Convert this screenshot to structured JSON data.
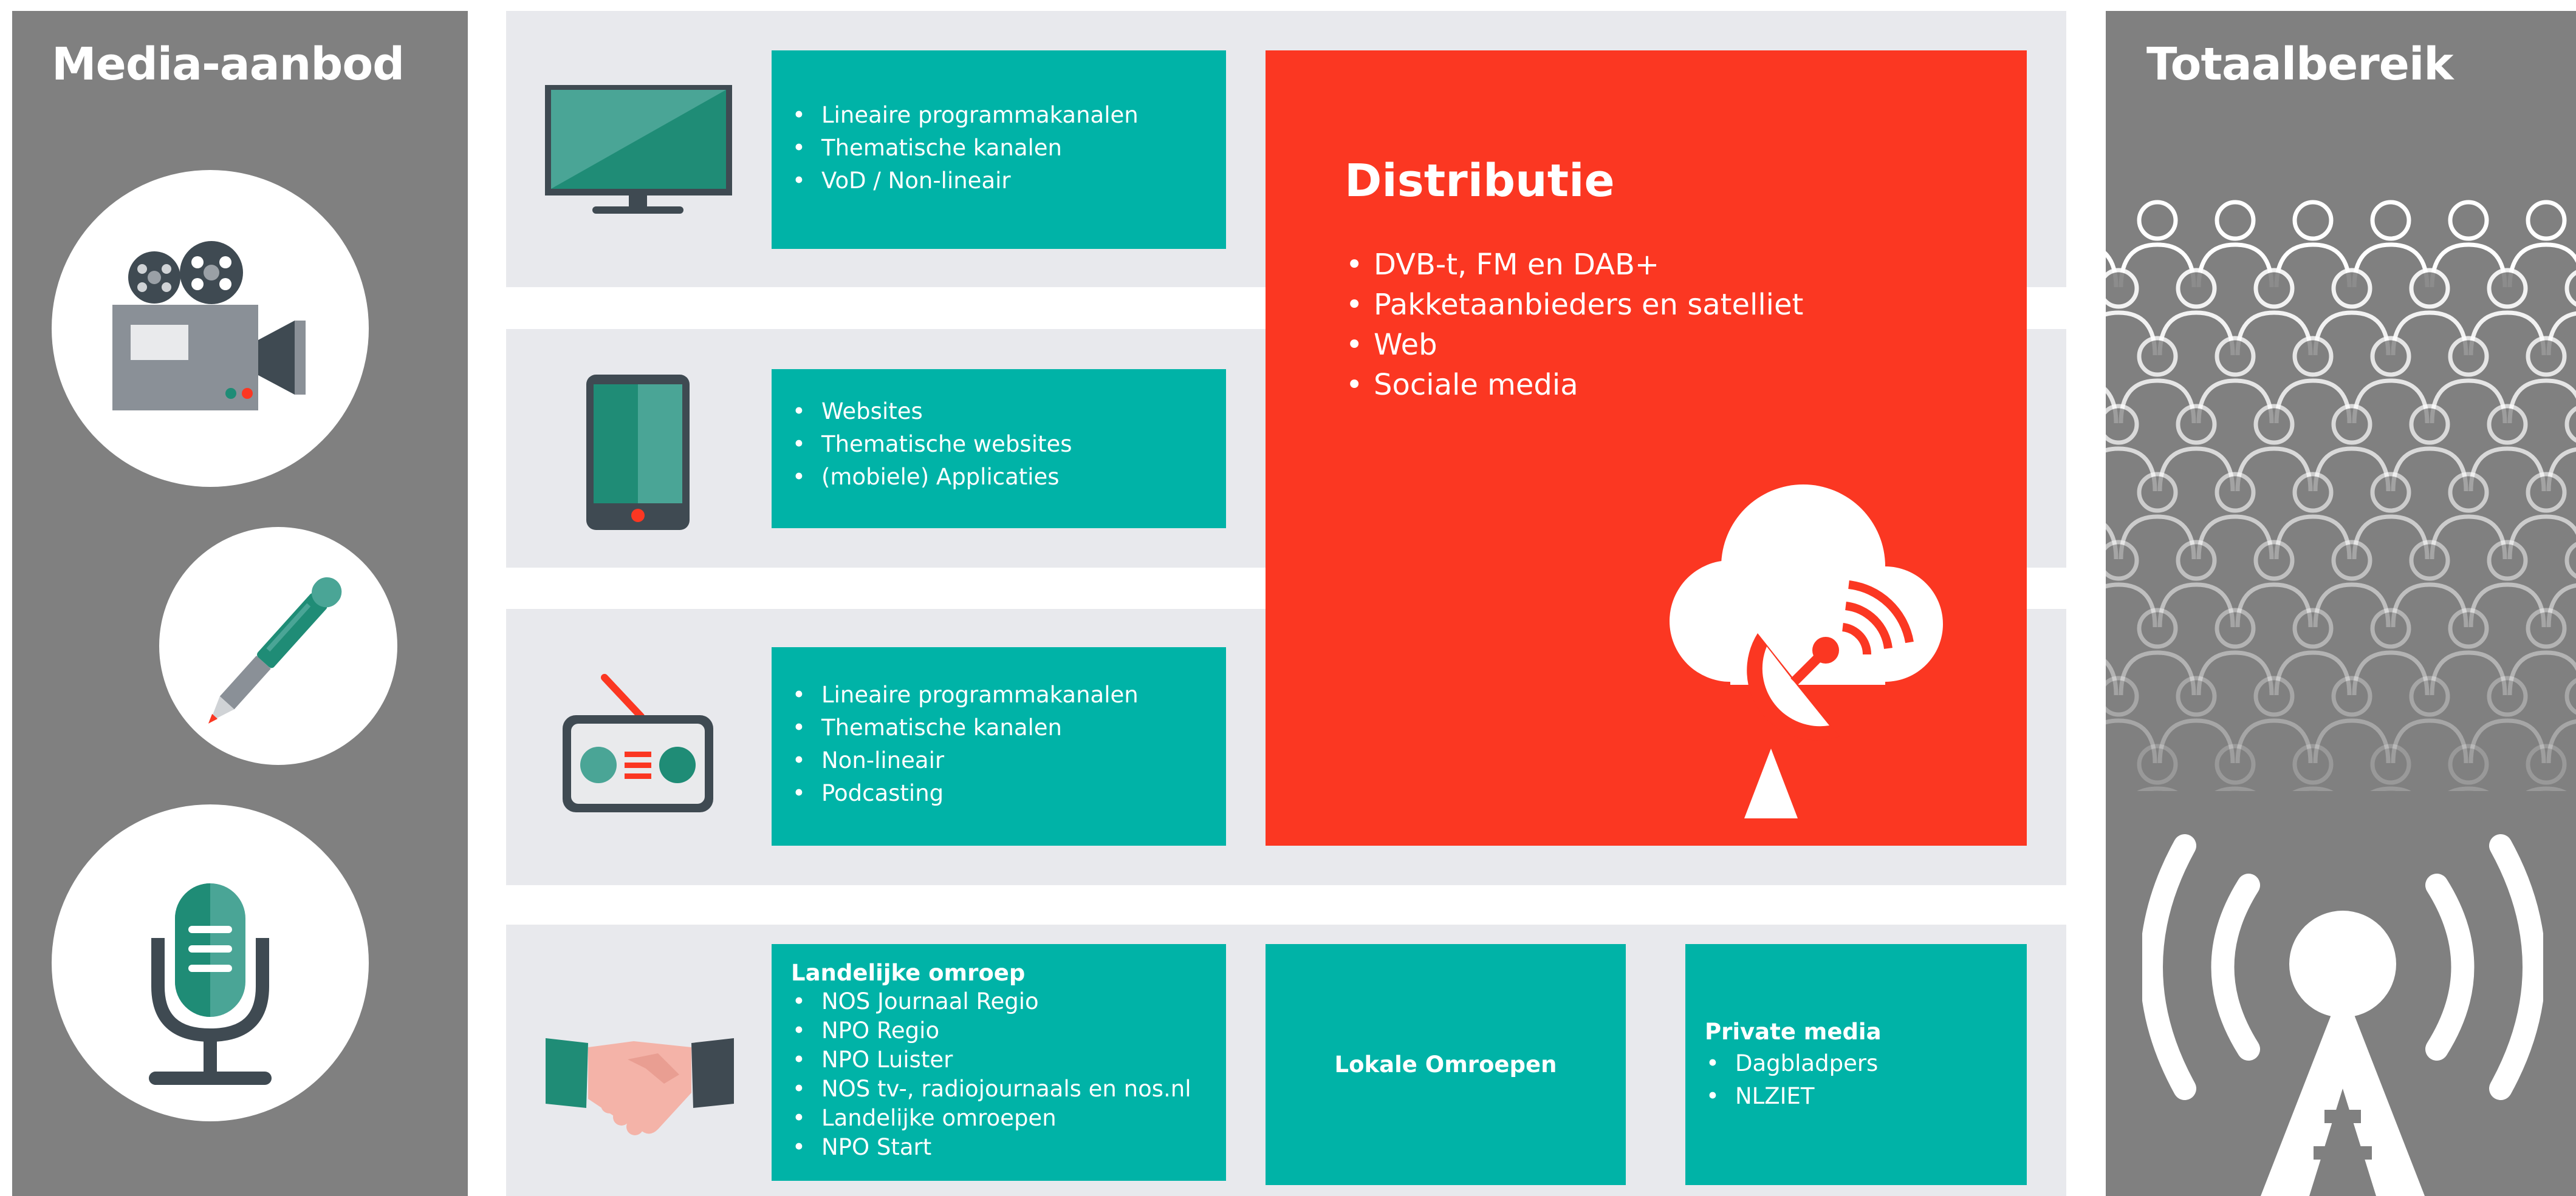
{
  "left_panel": {
    "title": "Media-aanbod"
  },
  "right_panel": {
    "title": "Totaalbereik"
  },
  "rows": {
    "tv": {
      "items": [
        "Lineaire programmakanalen",
        "Thematische kanalen",
        "VoD / Non-lineair"
      ]
    },
    "online": {
      "items": [
        "Websites",
        "Thematische websites",
        "(mobiele) Applicaties"
      ]
    },
    "radio": {
      "items": [
        "Lineaire programmakanalen",
        "Thematische kanalen",
        "Non-lineair",
        "Podcasting"
      ]
    }
  },
  "distributie": {
    "title": "Distributie",
    "items": [
      "DVB-t, FM en DAB+",
      "Pakketaanbieders en satelliet",
      "Web",
      "Sociale media"
    ]
  },
  "partners": {
    "landelijke": {
      "title": "Landelijke omroep",
      "items": [
        "NOS Journaal Regio",
        "NPO Regio",
        "NPO Luister",
        "NOS tv-, radiojournaals en nos.nl",
        "Landelijke omroepen",
        "NPO Start"
      ]
    },
    "lokale": {
      "title": "Lokale Omroepen"
    },
    "private": {
      "title": "Private media",
      "items": [
        "Dagbladpers",
        "NLZIET"
      ]
    }
  },
  "colors": {
    "panel_grey": "#808080",
    "row_bg": "#e8e9ed",
    "teal": "#00b3a7",
    "red": "#fb3722",
    "dark_green": "#1f8c76",
    "mid_green": "#4aa596",
    "dark_slate": "#3f4a52"
  },
  "icons": {
    "left_panel": [
      "film-camera-icon",
      "pen-icon",
      "microphone-icon"
    ],
    "rows": [
      "television-icon",
      "tablet-icon",
      "radio-icon",
      "handshake-icon"
    ],
    "distributie": "cloud-satellite-icon",
    "right_panel": [
      "audience-crowd-icon",
      "broadcast-tower-icon"
    ]
  }
}
